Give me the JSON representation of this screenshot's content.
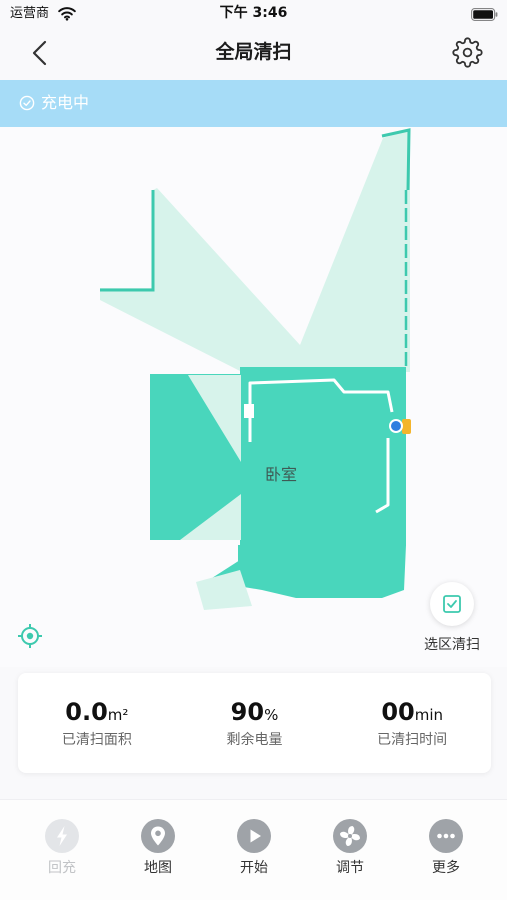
{
  "status_bar": {
    "carrier": "运营商",
    "time": "下午 3:46",
    "wifi_icon": "wifi-icon",
    "battery_icon": "battery-icon"
  },
  "header": {
    "title": "全局清扫",
    "back_icon": "chevron-left-icon",
    "settings_icon": "gear-icon"
  },
  "banner": {
    "icon": "check-circle-icon",
    "status": "充电中",
    "color": "#a6dcf7"
  },
  "map": {
    "room_label": "卧室",
    "robot_icon": "robot-icon",
    "dock_icon": "charging-dock-icon",
    "colors": {
      "explored": "#d7f3eb",
      "room": "#49d6bc",
      "border": "#3dc9ae",
      "robot": "#2f7fe0",
      "dock": "#f4b52c"
    }
  },
  "map_controls": {
    "locate_icon": "crosshair-icon",
    "select_area": {
      "icon": "checkbox-icon",
      "label": "选区清扫"
    }
  },
  "stats": [
    {
      "value": "0.0",
      "unit": "m²",
      "label": "已清扫面积"
    },
    {
      "value": "90",
      "unit": "%",
      "label": "剩余电量"
    },
    {
      "value": "00",
      "unit": "min",
      "label": "已清扫时间"
    }
  ],
  "tabbar": [
    {
      "label": "回充",
      "icon": "lightning-icon",
      "disabled": true
    },
    {
      "label": "地图",
      "icon": "map-pin-icon",
      "disabled": false
    },
    {
      "label": "开始",
      "icon": "play-icon",
      "disabled": false
    },
    {
      "label": "调节",
      "icon": "fan-icon",
      "disabled": false
    },
    {
      "label": "更多",
      "icon": "more-icon",
      "disabled": false
    }
  ]
}
